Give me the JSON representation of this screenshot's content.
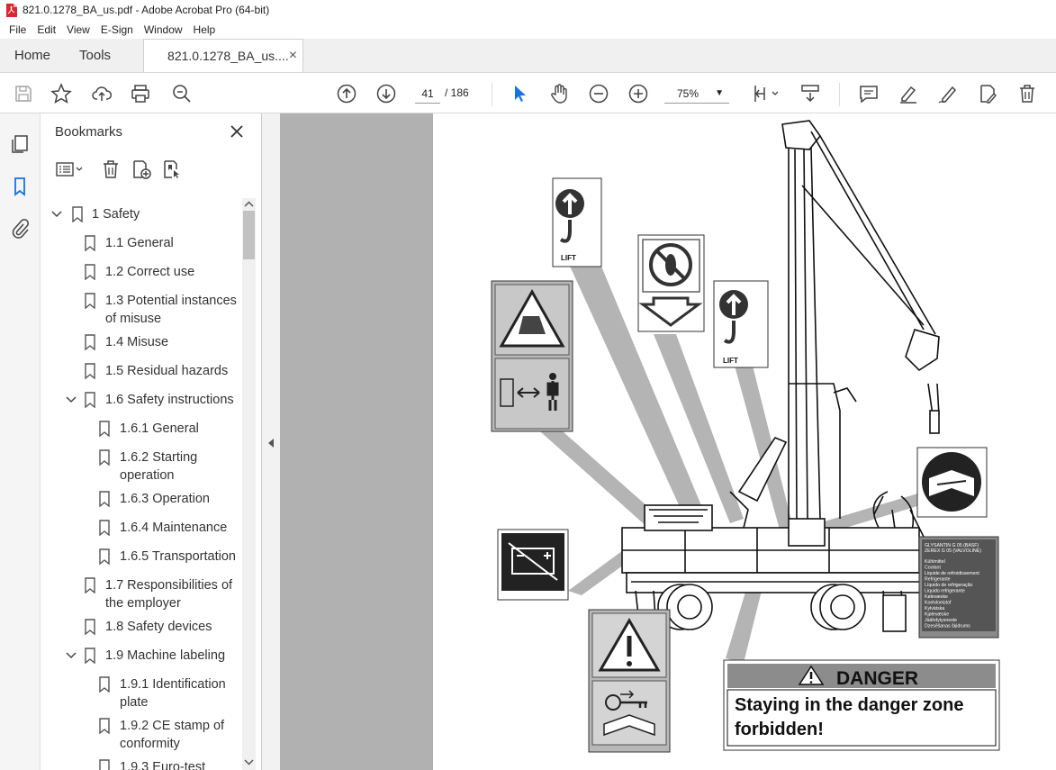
{
  "window": {
    "title": "821.0.1278_BA_us.pdf - Adobe Acrobat Pro (64-bit)"
  },
  "menu": [
    "File",
    "Edit",
    "View",
    "E-Sign",
    "Window",
    "Help"
  ],
  "tabs": {
    "home": "Home",
    "tools": "Tools",
    "doc": "821.0.1278_BA_us....",
    "close": "×"
  },
  "toolbar": {
    "page_current": "41",
    "page_total": "/ 186",
    "zoom": "75%"
  },
  "bookmarks": {
    "title": "Bookmarks",
    "items": [
      {
        "label": "1 Safety"
      },
      {
        "label": "1.1 General"
      },
      {
        "label": "1.2 Correct use"
      },
      {
        "label": "1.3 Potential instances of misuse"
      },
      {
        "label": "1.4 Misuse"
      },
      {
        "label": "1.5 Residual hazards"
      },
      {
        "label": "1.6 Safety instructions"
      },
      {
        "label": "1.6.1 General"
      },
      {
        "label": "1.6.2 Starting operation"
      },
      {
        "label": "1.6.3 Operation"
      },
      {
        "label": "1.6.4 Maintenance"
      },
      {
        "label": "1.6.5 Transportation"
      },
      {
        "label": "1.7 Responsibilities of the employer"
      },
      {
        "label": "1.8 Safety devices"
      },
      {
        "label": "1.9 Machine labeling"
      },
      {
        "label": "1.9.1 Identification plate"
      },
      {
        "label": "1.9.2 CE stamp of conformity"
      },
      {
        "label": "1.9.3 Euro-test"
      }
    ]
  },
  "document": {
    "lift_label": "LIFT",
    "danger_word": "DANGER",
    "danger_line1": "Staying in the danger zone",
    "danger_line2": "forbidden!",
    "coolant_lines": [
      "GLYSANTIN G 05 (BASF)",
      "ZEREX G 05 (VALVOLINE)",
      "Kühlmittel",
      "Coolant",
      "Liquide de refroidissement",
      "Refrigerante",
      "Líquido de refrigeração",
      "Liquido refrigerante",
      "Kølevæske",
      "Koelvloeistof",
      "Kylvätska",
      "Kjølevæske",
      "Jäähdytysneste",
      "Dzesēšanas šķidrums"
    ]
  },
  "colors": {
    "accent": "#1473e6",
    "viewer_bg": "#b1b1b1",
    "pdf_red": "#d7282f"
  }
}
